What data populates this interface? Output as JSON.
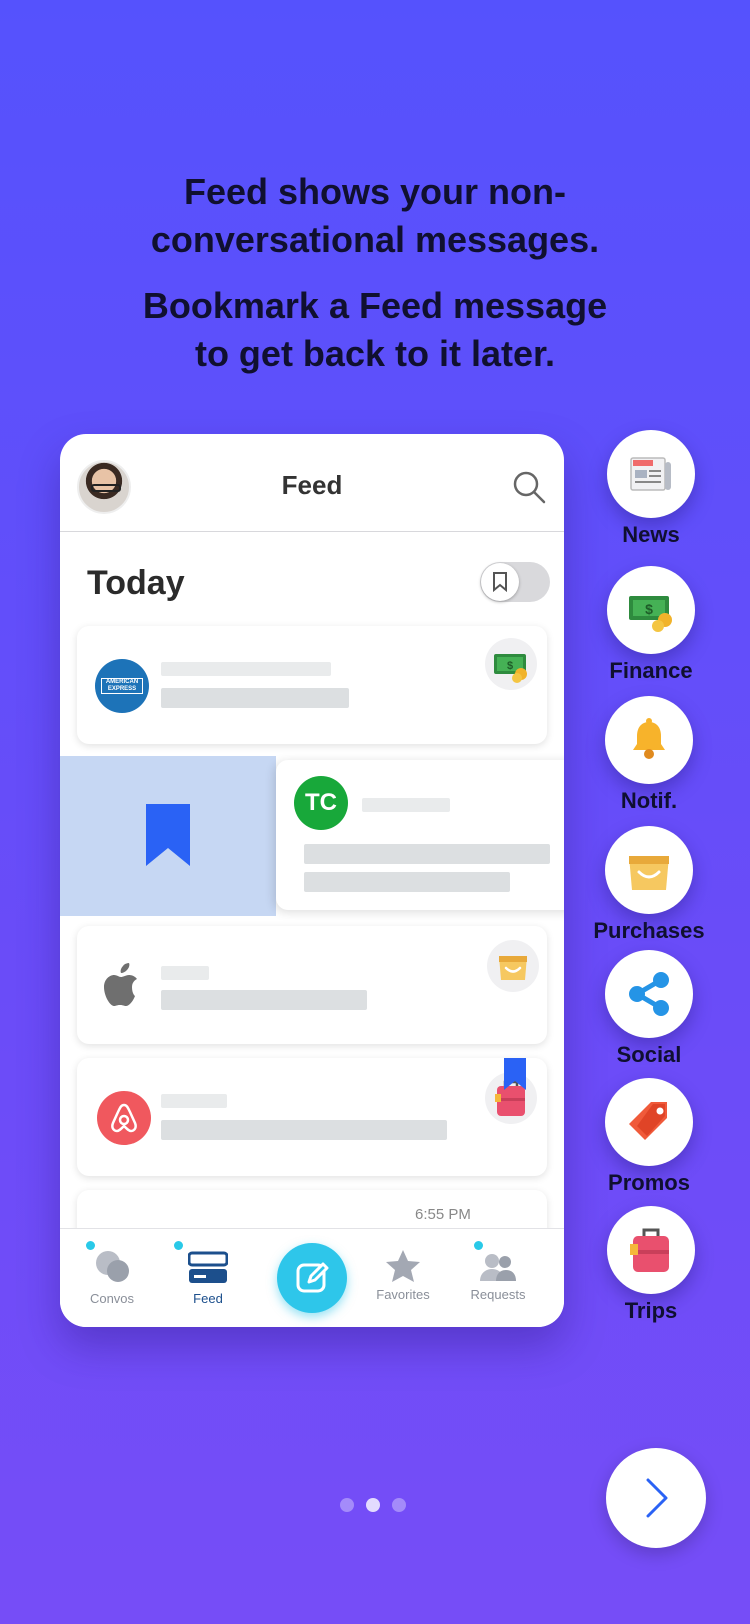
{
  "intro": {
    "line1": "Feed shows your non-",
    "line2": "conversational messages.",
    "line3": "Bookmark a Feed message",
    "line4": "to get back to it later."
  },
  "feed": {
    "title": "Feed",
    "section": "Today",
    "time": "6:55 PM",
    "cards": [
      {
        "sender_logo": "american-express-logo",
        "category_icon": "finance-icon",
        "logo_text": "AMERICAN EXPRESS"
      },
      {
        "sender_logo": "techcrunch-logo",
        "logo_text": "TC"
      },
      {
        "sender_logo": "apple-logo",
        "category_icon": "purchases-icon"
      },
      {
        "sender_logo": "airbnb-logo",
        "category_icon": "trips-icon",
        "bookmarked": true
      }
    ]
  },
  "tabbar": {
    "convos": "Convos",
    "feed": "Feed",
    "favorites": "Favorites",
    "requests": "Requests"
  },
  "categories": [
    {
      "label": "News",
      "icon": "news-icon"
    },
    {
      "label": "Finance",
      "icon": "finance-icon"
    },
    {
      "label": "Notif.",
      "icon": "bell-icon"
    },
    {
      "label": "Purchases",
      "icon": "shopping-bag-icon"
    },
    {
      "label": "Social",
      "icon": "share-icon"
    },
    {
      "label": "Promos",
      "icon": "tag-icon"
    },
    {
      "label": "Trips",
      "icon": "suitcase-icon"
    }
  ],
  "pager": {
    "count": 3,
    "active": 2
  },
  "colors": {
    "background": "#5a50fb",
    "accent": "#2ec6ea",
    "bookmark": "#2a62f5"
  }
}
